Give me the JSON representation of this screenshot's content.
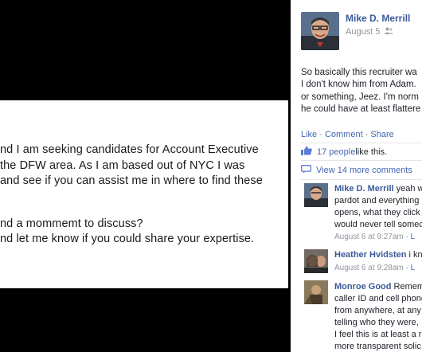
{
  "email": {
    "lines": [
      "nd I am seeking candidates for Account Executive",
      "the DFW area. As I am based out of NYC I was",
      "and see if you can assist me in where to find these",
      "",
      "nd a mommemt to discuss?",
      "nd let me know if you could share your expertise."
    ]
  },
  "post": {
    "author": "Mike D. Merrill",
    "date": "August 5",
    "text_lines": [
      "So basically this recruiter wa",
      "I don't know him from Adam.",
      "or something, Jeez. I'm norm",
      "he could have at least flattere"
    ],
    "actions": "Like · Comment · Share",
    "likes": {
      "link": "17 people",
      "rest": " like this."
    },
    "view_more": "View 14 more comments"
  },
  "comments": [
    {
      "name": "Mike D. Merrill",
      "text_first": " yeah w",
      "lines": [
        "pardot and everything",
        "opens, what they click",
        "would never tell somec"
      ],
      "time": "August 6 at 9:27am",
      "like": " · L"
    },
    {
      "name": "Heather Hvidsten",
      "text_first": " i kn",
      "lines": [],
      "time": "August 6 at 9:28am",
      "like": " · L"
    },
    {
      "name": "Monroe Good",
      "text_first": " Remem",
      "lines": [
        "caller ID and cell phone",
        "from anywhere, at any",
        "telling who they were,",
        "I feel this is at least a r",
        "more transparent solic"
      ],
      "time": "",
      "like": ""
    }
  ],
  "colors": {
    "link": "#3b5998",
    "meta": "#90949c",
    "text": "#1d2129"
  },
  "icons": [
    "thumbs-up-icon",
    "comment-icon",
    "friends-audience-icon"
  ]
}
